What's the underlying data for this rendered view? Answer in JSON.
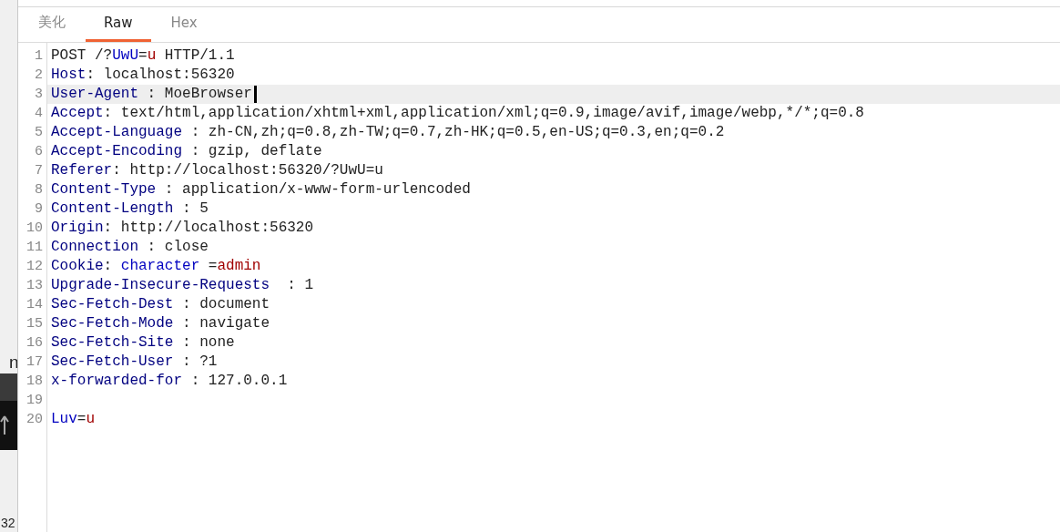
{
  "background_window": {
    "texts": [
      {
        "text": "n"
      },
      {
        "text": "32"
      }
    ]
  },
  "tabs": [
    {
      "label": "美化",
      "selected": false
    },
    {
      "label": "Raw",
      "selected": true
    },
    {
      "label": "Hex",
      "selected": false
    }
  ],
  "editor": {
    "lines": [
      {
        "number": "1",
        "current": false,
        "segments": [
          {
            "kind": "plain",
            "text": "POST /?"
          },
          {
            "kind": "param",
            "text": "UwU"
          },
          {
            "kind": "plain",
            "text": "="
          },
          {
            "kind": "value",
            "text": "u"
          },
          {
            "kind": "plain",
            "text": " HTTP/1.1"
          }
        ]
      },
      {
        "number": "2",
        "current": false,
        "segments": [
          {
            "kind": "key",
            "text": "Host"
          },
          {
            "kind": "plain",
            "text": ": localhost:56320"
          }
        ]
      },
      {
        "number": "3",
        "current": true,
        "segments": [
          {
            "kind": "key",
            "text": "User-Agent"
          },
          {
            "kind": "plain",
            "text": " : MoeBrowser"
          }
        ]
      },
      {
        "number": "4",
        "current": false,
        "segments": [
          {
            "kind": "key",
            "text": "Accept"
          },
          {
            "kind": "plain",
            "text": ": text/html,application/xhtml+xml,application/xml;q=0.9,image/avif,image/webp,*/*;q=0.8"
          }
        ]
      },
      {
        "number": "5",
        "current": false,
        "segments": [
          {
            "kind": "key",
            "text": "Accept-Language"
          },
          {
            "kind": "plain",
            "text": " : zh-CN,zh;q=0.8,zh-TW;q=0.7,zh-HK;q=0.5,en-US;q=0.3,en;q=0.2"
          }
        ]
      },
      {
        "number": "6",
        "current": false,
        "segments": [
          {
            "kind": "key",
            "text": "Accept-Encoding"
          },
          {
            "kind": "plain",
            "text": " : gzip, deflate"
          }
        ]
      },
      {
        "number": "7",
        "current": false,
        "segments": [
          {
            "kind": "key",
            "text": "Referer"
          },
          {
            "kind": "plain",
            "text": ": http://localhost:56320/?UwU=u"
          }
        ]
      },
      {
        "number": "8",
        "current": false,
        "segments": [
          {
            "kind": "key",
            "text": "Content-Type"
          },
          {
            "kind": "plain",
            "text": " : application/x-www-form-urlencoded"
          }
        ]
      },
      {
        "number": "9",
        "current": false,
        "segments": [
          {
            "kind": "key",
            "text": "Content-Length"
          },
          {
            "kind": "plain",
            "text": " : 5"
          }
        ]
      },
      {
        "number": "10",
        "current": false,
        "segments": [
          {
            "kind": "key",
            "text": "Origin"
          },
          {
            "kind": "plain",
            "text": ": http://localhost:56320"
          }
        ]
      },
      {
        "number": "11",
        "current": false,
        "segments": [
          {
            "kind": "key",
            "text": "Connection"
          },
          {
            "kind": "plain",
            "text": " : close"
          }
        ]
      },
      {
        "number": "12",
        "current": false,
        "segments": [
          {
            "kind": "key",
            "text": "Cookie"
          },
          {
            "kind": "plain",
            "text": ": "
          },
          {
            "kind": "param",
            "text": "character"
          },
          {
            "kind": "plain",
            "text": " ="
          },
          {
            "kind": "value",
            "text": "admin"
          }
        ]
      },
      {
        "number": "13",
        "current": false,
        "segments": [
          {
            "kind": "key",
            "text": "Upgrade-Insecure-Requests"
          },
          {
            "kind": "plain",
            "text": "  : 1"
          }
        ]
      },
      {
        "number": "14",
        "current": false,
        "segments": [
          {
            "kind": "key",
            "text": "Sec-Fetch-Dest"
          },
          {
            "kind": "plain",
            "text": " : document"
          }
        ]
      },
      {
        "number": "15",
        "current": false,
        "segments": [
          {
            "kind": "key",
            "text": "Sec-Fetch-Mode"
          },
          {
            "kind": "plain",
            "text": " : navigate"
          }
        ]
      },
      {
        "number": "16",
        "current": false,
        "segments": [
          {
            "kind": "key",
            "text": "Sec-Fetch-Site"
          },
          {
            "kind": "plain",
            "text": " : none"
          }
        ]
      },
      {
        "number": "17",
        "current": false,
        "segments": [
          {
            "kind": "key",
            "text": "Sec-Fetch-User"
          },
          {
            "kind": "plain",
            "text": " : ?1"
          }
        ]
      },
      {
        "number": "18",
        "current": false,
        "segments": [
          {
            "kind": "key",
            "text": "x-forwarded-for"
          },
          {
            "kind": "plain",
            "text": " : 127.0.0.1"
          }
        ]
      },
      {
        "number": "19",
        "current": false
      },
      {
        "number": "20",
        "current": false,
        "segments": [
          {
            "kind": "param",
            "text": "Luv"
          },
          {
            "kind": "plain",
            "text": "="
          },
          {
            "kind": "value",
            "text": "u"
          }
        ]
      }
    ]
  }
}
